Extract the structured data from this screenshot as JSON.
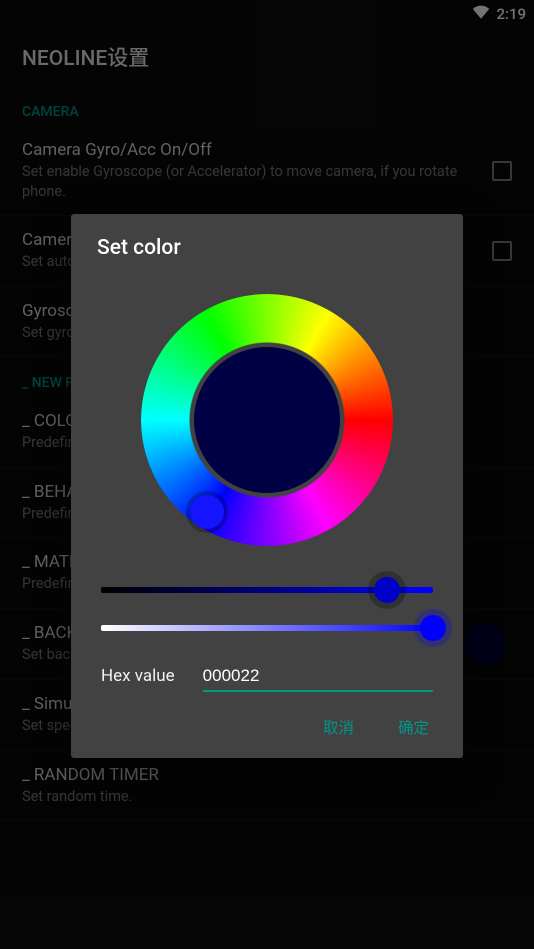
{
  "status": {
    "time": "2:19"
  },
  "header": {
    "title": "NEOLINE设置"
  },
  "sections": {
    "camera_label": "CAMERA",
    "newfile_label": "_ NEW F"
  },
  "prefs": {
    "gyro": {
      "title": "Camera Gyro/Acc On/Off",
      "sub": "Set enable Gyroscope (or Accelerator) to move camera, if you rotate phone."
    },
    "camera2": {
      "title": "Camera",
      "sub": "Set auto"
    },
    "gyrosc": {
      "title": "Gyrosc",
      "sub": "Set gyro"
    },
    "color": {
      "title": "_ COLO",
      "sub": "Predefin"
    },
    "beha": {
      "title": "_ BEHA",
      "sub": "Predefin"
    },
    "mate": {
      "title": "_ MATE",
      "sub": "Predefin"
    },
    "back": {
      "title": "_ BACK",
      "sub": "Set back"
    },
    "sim": {
      "title": "_ Simulation speed",
      "sub": "Set speed of simulation."
    },
    "rand": {
      "title": "_ RANDOM TIMER",
      "sub": "Set random time."
    }
  },
  "dialog": {
    "title": "Set color",
    "hex_label": "Hex value",
    "hex_value": "000022",
    "cancel": "取消",
    "ok": "确定",
    "preview_color": "#000044"
  }
}
